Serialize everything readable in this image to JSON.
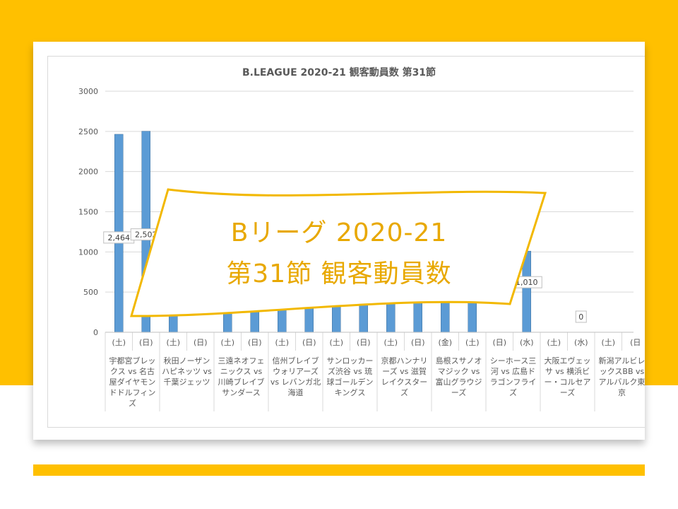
{
  "banner": {
    "line1": "Bリーグ 2020-21",
    "line2": "第31節 観客動員数"
  },
  "chart_data": {
    "type": "bar",
    "title": "B.LEAGUE 2020-21 観客動員数 第31節",
    "ylim": [
      0,
      3000
    ],
    "yticks": [
      0,
      500,
      1000,
      1500,
      2000,
      2500,
      3000
    ],
    "grid": true,
    "categories": [
      "(土)",
      "(日)",
      "(土)",
      "(日)",
      "(土)",
      "(日)",
      "(土)",
      "(日)",
      "(土)",
      "(日)",
      "(土)",
      "(日)",
      "(金)",
      "(土)",
      "(日)",
      "(水)",
      "(土)",
      "(水)",
      "(土)",
      "(日"
    ],
    "groups": [
      "宇都宮ブレックス vs 名古屋ダイヤモンドドルフィンズ",
      "秋田ノーザンハピネッツ vs 千葉ジェッツ",
      "三遠ネオフェニックス vs 川崎ブレイブサンダース",
      "信州ブレイブウォリアーズ vs レバンガ北海道",
      "サンロッカーズ渋谷 vs 琉球ゴールデンキングス",
      "京都ハンナリーズ vs 滋賀レイクスターズ",
      "島根スサノオマジック vs 富山グラウジーズ",
      "シーホース三河 vs 広島ドラゴンフライズ",
      "大阪エヴェッサ vs 横浜ビー・コルセアーズ",
      "新潟アルビレックスBB vs アルバルク東京"
    ],
    "values": [
      2464,
      2502,
      1600,
      0,
      1000,
      1000,
      1000,
      1000,
      1000,
      1000,
      1000,
      1000,
      1000,
      1000,
      0,
      1010,
      0,
      0,
      null,
      null
    ],
    "data_labels": [
      "2,464",
      "2,502",
      "",
      "",
      "",
      "",
      "",
      "",
      "",
      "",
      "",
      "",
      "",
      "",
      "",
      "1,010",
      "",
      "0",
      "",
      ""
    ],
    "bar_color": "#5B9BD5"
  }
}
